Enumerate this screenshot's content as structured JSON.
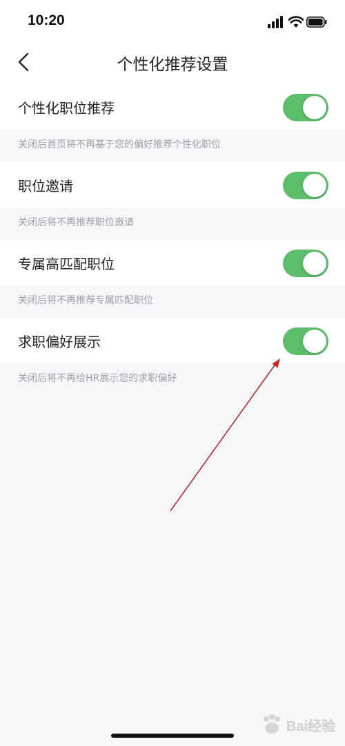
{
  "status_bar": {
    "time": "10:20",
    "icons": [
      "signal-icon",
      "wifi-icon",
      "battery-icon"
    ]
  },
  "nav": {
    "title": "个性化推荐设置",
    "back_icon": "chevron-left-icon"
  },
  "settings": [
    {
      "label": "个性化职位推荐",
      "enabled": true,
      "hint": "关闭后首页将不再基于您的偏好推荐个性化职位"
    },
    {
      "label": "职位邀请",
      "enabled": true,
      "hint": "关闭后将不再推荐职位邀请"
    },
    {
      "label": "专属高匹配职位",
      "enabled": true,
      "hint": "关闭后将不再推荐专属匹配职位"
    },
    {
      "label": "求职偏好展示",
      "enabled": true,
      "hint": "关闭后将不再给HR展示您的求职偏好"
    }
  ],
  "colors": {
    "toggle_on": "#5cbd6a",
    "background": "#f7f7f9",
    "hint_text": "#a0a0a6",
    "annotation_arrow": "#c0262a"
  },
  "watermark": {
    "text": "Bai经验"
  }
}
